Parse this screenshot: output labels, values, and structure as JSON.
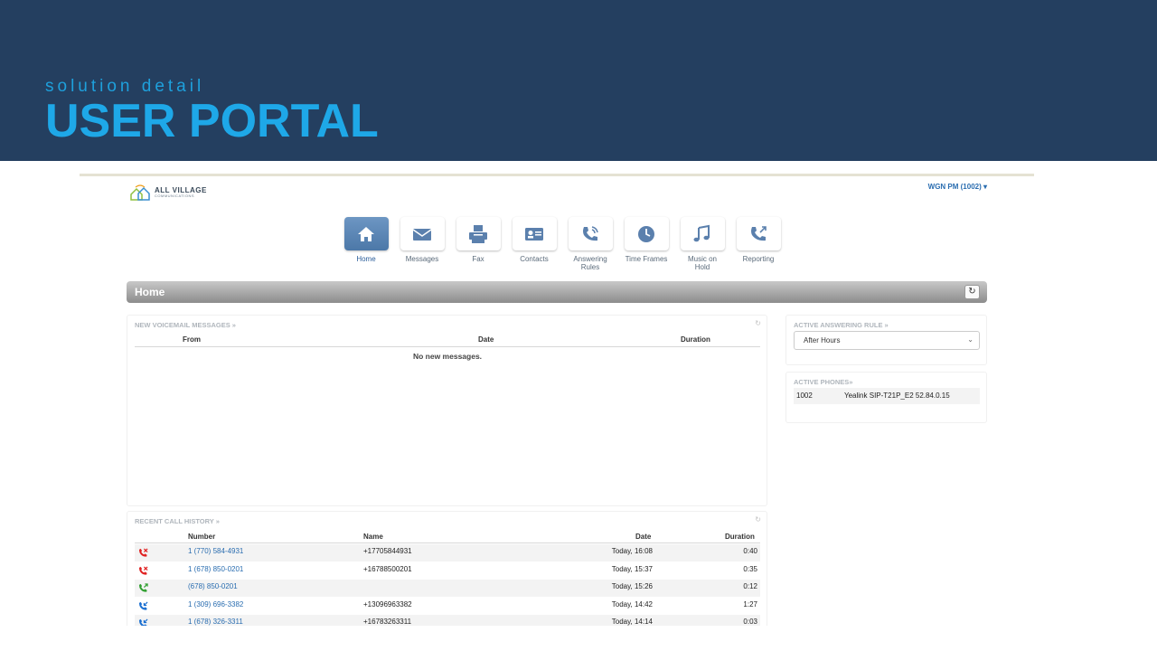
{
  "slide": {
    "subtitle": "solution detail",
    "title": "USER PORTAL"
  },
  "portal": {
    "logo": {
      "name": "ALL VILLAGE",
      "tagline": "COMMUNICATIONS"
    },
    "user_menu": "WGN PM (1002) ▾",
    "nav": [
      {
        "label": "Home",
        "icon": "home-icon",
        "active": true
      },
      {
        "label": "Messages",
        "icon": "envelope-icon"
      },
      {
        "label": "Fax",
        "icon": "fax-icon"
      },
      {
        "label": "Contacts",
        "icon": "contact-card-icon"
      },
      {
        "label": "Answering Rules",
        "icon": "phone-rules-icon"
      },
      {
        "label": "Time Frames",
        "icon": "clock-icon"
      },
      {
        "label": "Music on Hold",
        "icon": "music-note-icon"
      },
      {
        "label": "Reporting",
        "icon": "phone-reporting-icon"
      }
    ],
    "home_bar": {
      "title": "Home",
      "refresh_icon": "refresh-icon"
    },
    "voicemail": {
      "title": "NEW VOICEMAIL MESSAGES »",
      "columns": {
        "from": "From",
        "date": "Date",
        "duration": "Duration"
      },
      "empty": "No new messages."
    },
    "call_history": {
      "title": "RECENT CALL HISTORY »",
      "columns": {
        "number": "Number",
        "name": "Name",
        "date": "Date",
        "duration": "Duration"
      },
      "rows": [
        {
          "type": "missed",
          "number": "1 (770) 584-4931",
          "name": "+17705844931",
          "date": "Today, 16:08",
          "duration": "0:40"
        },
        {
          "type": "missed",
          "number": "1 (678) 850-0201",
          "name": "+16788500201",
          "date": "Today, 15:37",
          "duration": "0:35"
        },
        {
          "type": "outgoing",
          "number": "(678) 850-0201",
          "name": "",
          "date": "Today, 15:26",
          "duration": "0:12"
        },
        {
          "type": "incoming",
          "number": "1 (309) 696-3382",
          "name": "+13096963382",
          "date": "Today, 14:42",
          "duration": "1:27"
        },
        {
          "type": "incoming",
          "number": "1 (678) 326-3311",
          "name": "+16783263311",
          "date": "Today, 14:14",
          "duration": "0:03"
        }
      ],
      "colors": {
        "missed": "#e02020",
        "outgoing": "#2e9e2e",
        "incoming": "#1a6fd1"
      }
    },
    "answering_rule": {
      "title": "ACTIVE ANSWERING RULE »",
      "selected": "After Hours"
    },
    "active_phones": {
      "title": "ACTIVE PHONES»",
      "ext": "1002",
      "model": "Yealink SIP-T21P_E2 52.84.0.15"
    }
  }
}
